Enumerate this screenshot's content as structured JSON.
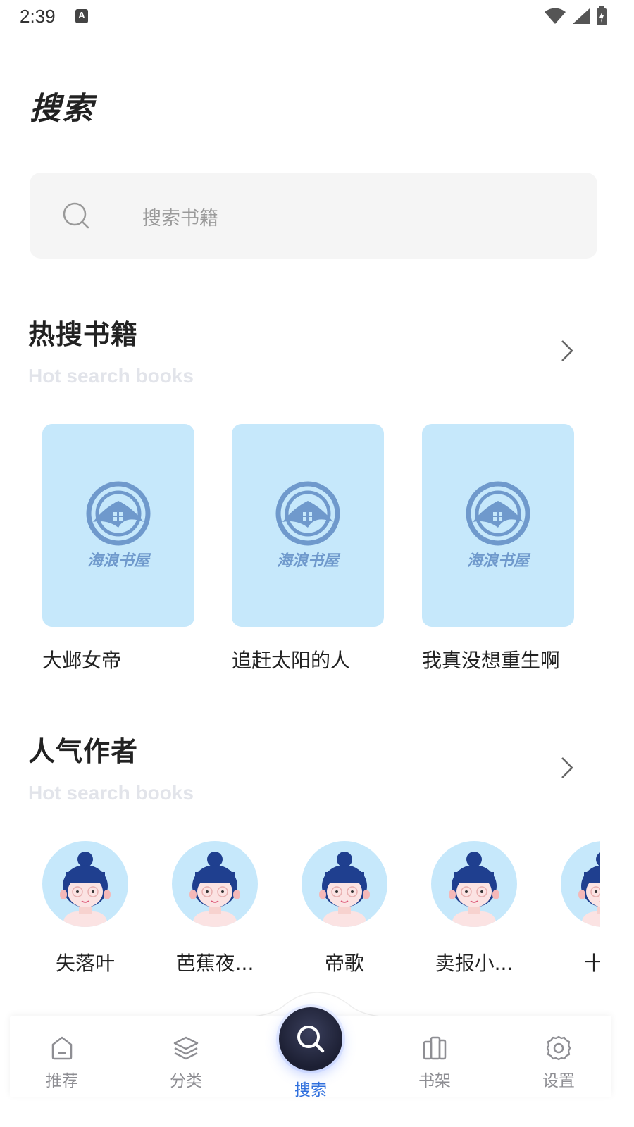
{
  "status_bar": {
    "time": "2:39",
    "notification_badge": "A"
  },
  "page": {
    "title": "搜索"
  },
  "search": {
    "placeholder": "搜索书籍"
  },
  "hot_books": {
    "title": "热搜书籍",
    "subtitle": "Hot search books",
    "items": [
      {
        "title": "大邺女帝",
        "cover_logo_text": "海浪书屋"
      },
      {
        "title": "追赶太阳的人",
        "cover_logo_text": "海浪书屋"
      },
      {
        "title": "我真没想重生啊",
        "cover_logo_text": "海浪书屋"
      }
    ]
  },
  "popular_authors": {
    "title": "人气作者",
    "subtitle": "Hot search books",
    "items": [
      {
        "name": "失落叶"
      },
      {
        "name": "芭蕉夜..."
      },
      {
        "name": "帝歌"
      },
      {
        "name": "卖报小..."
      },
      {
        "name": "十年"
      }
    ]
  },
  "bottom_nav": {
    "items": [
      {
        "label": "推荐",
        "icon": "home-icon"
      },
      {
        "label": "分类",
        "icon": "layers-icon"
      },
      {
        "label": "搜索",
        "icon": "search-icon",
        "active": true
      },
      {
        "label": "书架",
        "icon": "bookshelf-icon"
      },
      {
        "label": "设置",
        "icon": "settings-icon"
      }
    ]
  },
  "colors": {
    "accent": "#2f6fdd",
    "cover_bg": "#c6e8fb",
    "logo_blue": "#6f99cc",
    "subtitle_gray": "#e2e4ea"
  }
}
